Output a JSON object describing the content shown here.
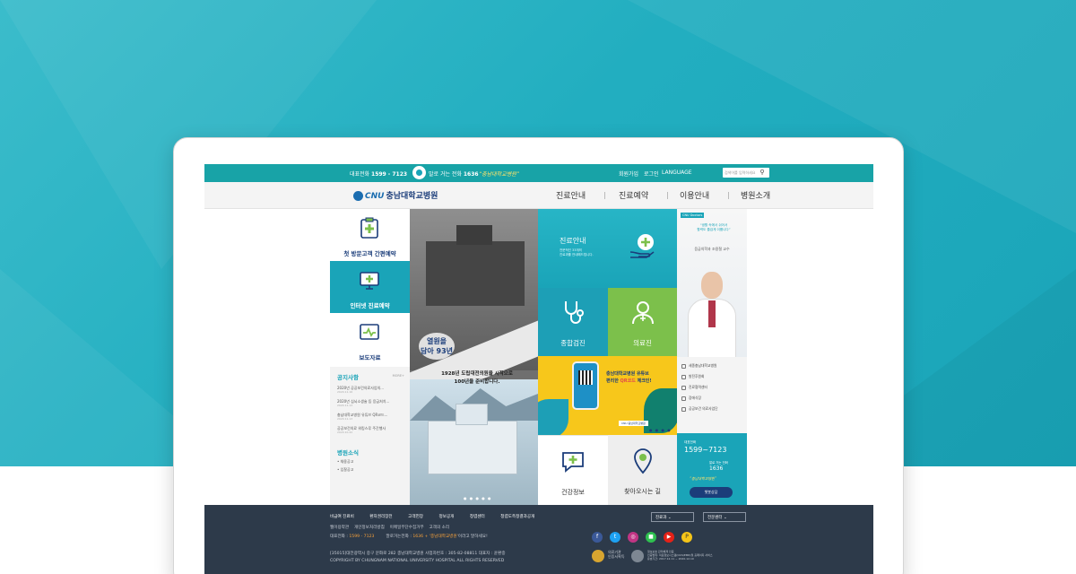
{
  "util": {
    "phone_label": "대표전화",
    "phone": "1599 - 7123",
    "call_label": "말로 거는 전화",
    "call_num": "1636",
    "slogan": "“충남대학교병원”",
    "join": "회원가입",
    "login": "로그인",
    "language": "LANGUAGE",
    "search_placeholder": "검색어를 입력하세요"
  },
  "header": {
    "logo_cnu": "CNU",
    "logo_text": "충남대학교병원",
    "nav": [
      "진료안내",
      "진료예약",
      "이용안내",
      "병원소개"
    ]
  },
  "left": {
    "first_visit": "첫 방문고객 간편예약",
    "internet": "인터넷 진료예약",
    "press": "보도자료",
    "notice_title": "공지사항",
    "more": "MORE+",
    "notices": [
      {
        "t": "2020년 공공보건의료사업의...",
        "d": "2020.11.16"
      },
      {
        "t": "2020년 심뇌소생술 등 응급처치...",
        "d": "2020.11.13"
      },
      {
        "t": "충남대학교병원 유튜브 QR코드...",
        "d": "2020.11.13"
      },
      {
        "t": "공공보건의료 워킹스루 주간행사",
        "d": "2020.10.22"
      }
    ],
    "news_title": "병원소식",
    "news": [
      "• 채용공고",
      "• 입찰공고"
    ]
  },
  "banner": {
    "years_line1": "열원을",
    "years_line2": "담아 93년",
    "caption_l1": "1928년 도립대전의원을 시작으로",
    "caption_l2": "100년을 준비합니다.",
    "dots": "● ● ● ● ●"
  },
  "tiles": {
    "guide_title": "진료안내",
    "guide_sub1": "전문적인 33개의",
    "guide_sub2": "진료과를 안내해드립니다.",
    "checkup": "종합검진",
    "doctors": "의료진",
    "qr_l1": "충남대학교병원 유튜브",
    "qr_l2a": "편리한 ",
    "qr_l2b": "QR코드",
    "qr_l2c": " 체크인!",
    "qr_mini": "CNU 충남대학교병원",
    "qr_dots": "● ● ● ●",
    "health": "건강정보",
    "directions": "찾아오시는 길"
  },
  "right": {
    "tag": "CNU Doctors",
    "quote1": "“생활 속에서 쉬어서",
    "quote2": "활력도 즐겁게 이룹니다”",
    "doctor_name": "응급의학과 조용철 교수",
    "links": [
      "세종충남대학교병원",
      "발전후원회",
      "진료협력센터",
      "장애식장",
      "공공보건 의료사업단"
    ],
    "call_label": "대표전화",
    "call_num": "1599~7123",
    "call2_label": "말로 거는 전화",
    "call2_num": "1636",
    "slogan": "“충남대학교병원”",
    "chat": "챗봇상담"
  },
  "footer": {
    "links1": [
      "비급여 진료비",
      "환자권리장전",
      "고객헌장",
      "정보공개",
      "청렴센터",
      "청렴도측정결과공개"
    ],
    "links2": [
      "웹이용약관",
      "개인정보처리방침",
      "이메일무단수집거부",
      "고객의 소리"
    ],
    "rep_label": "대표전화 : ",
    "rep_num": "1599 - 7123",
    "speak_label": "말로거는전화 : ",
    "speak_val": "1636 + '충남대학교병원'",
    "speak_tail": "이라고 말하세요!",
    "address": "[35015]대전광역시 중구 문화로 282 충남대학교병원 사업자번호 : 305-82-08811 대표자 : 윤환중",
    "copyright": "COPYRIGHT BY CHUNGNAM NATIONAL UNIVERSITY HOSPITAL ALL RIGHTS RESERVED",
    "select1": "진료과 ⌄",
    "select2": "전문센터 ⌄",
    "social": [
      "f",
      "t",
      "◎",
      "■",
      "▶",
      "P"
    ],
    "cert1_l1": "의료기관",
    "cert1_l2": "인증서획득",
    "cert2_l1": "정보보호 관리체계 인증",
    "cert2_l2": "인증범위: 의료정보시스템(OCS/EMR)및 홈페이지 서비스",
    "cert2_l3": "유효기간: 2017.12.11 ~ 2020.12.10"
  }
}
